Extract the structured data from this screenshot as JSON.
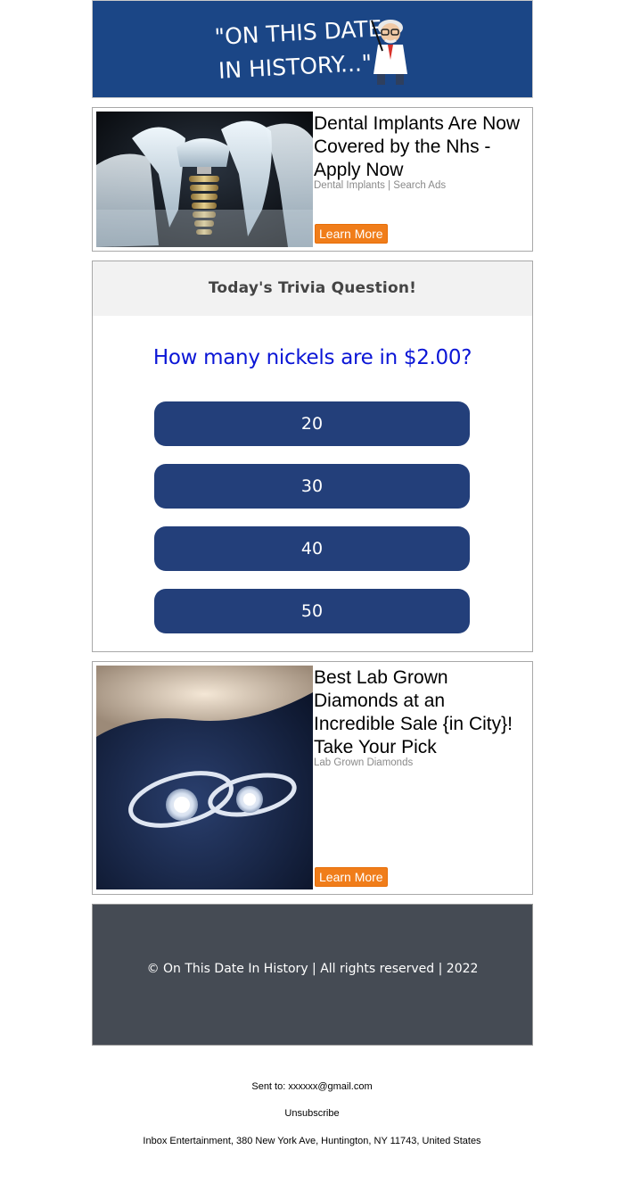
{
  "header": {
    "logo_line1": "\"ON THIS DATE",
    "logo_line2": "IN HISTORY...\""
  },
  "ads": [
    {
      "title": "Dental Implants Are Now Covered by the Nhs - Apply Now",
      "source": "Dental Implants | Search Ads",
      "button": "Learn More",
      "image": "dental-implant-image"
    },
    {
      "title": "Best Lab Grown Diamonds at an Incredible Sale {in City}! Take Your Pick",
      "source": "Lab Grown Diamonds",
      "button": "Learn More",
      "image": "diamond-rings-image"
    }
  ],
  "trivia": {
    "heading": "Today's Trivia Question!",
    "question": "How many nickels are in $2.00?",
    "answers": [
      "20",
      "30",
      "40",
      "50"
    ]
  },
  "footer": {
    "copyright": "© On This Date In History | All rights reserved | 2022"
  },
  "meta": {
    "sent_to_label": "Sent to:",
    "sent_to_email": "xxxxxx@gmail.com",
    "unsubscribe": "Unsubscribe",
    "address": "Inbox Entertainment, 380 New York Ave, Huntington, NY 11743, United States"
  },
  "colors": {
    "header_bg": "#1b4686",
    "answer_bg": "#233f7a",
    "question_text": "#0b16d6",
    "button_orange": "#f07d1a",
    "footer_bg": "#454b54"
  }
}
